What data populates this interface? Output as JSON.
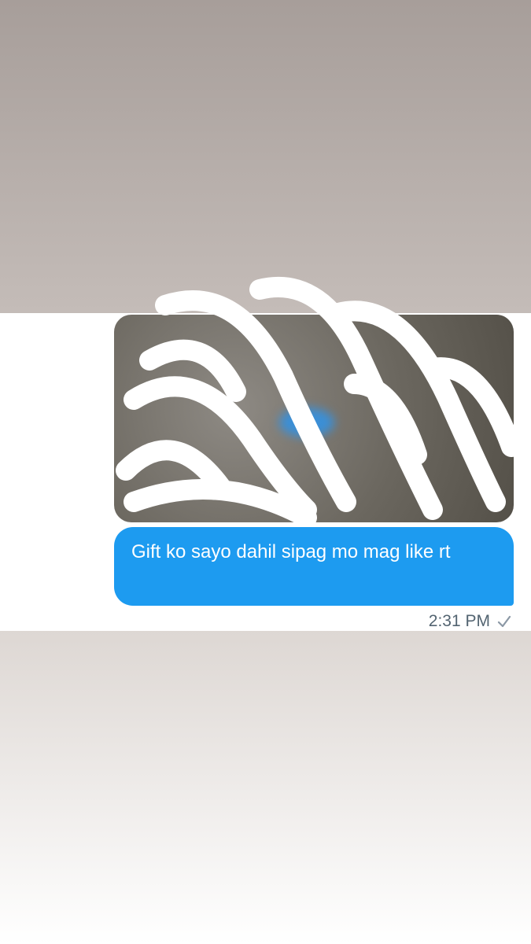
{
  "conversation": {
    "message": {
      "text": "Gift ko sayo dahil sipag mo mag like rt",
      "timestamp": "2:31 PM",
      "status_icon": "checkmark-icon",
      "attachment": "photo"
    }
  },
  "colors": {
    "bubble": "#1d9bf0",
    "bubble_text": "#ffffff",
    "timestamp_text": "#536471"
  }
}
